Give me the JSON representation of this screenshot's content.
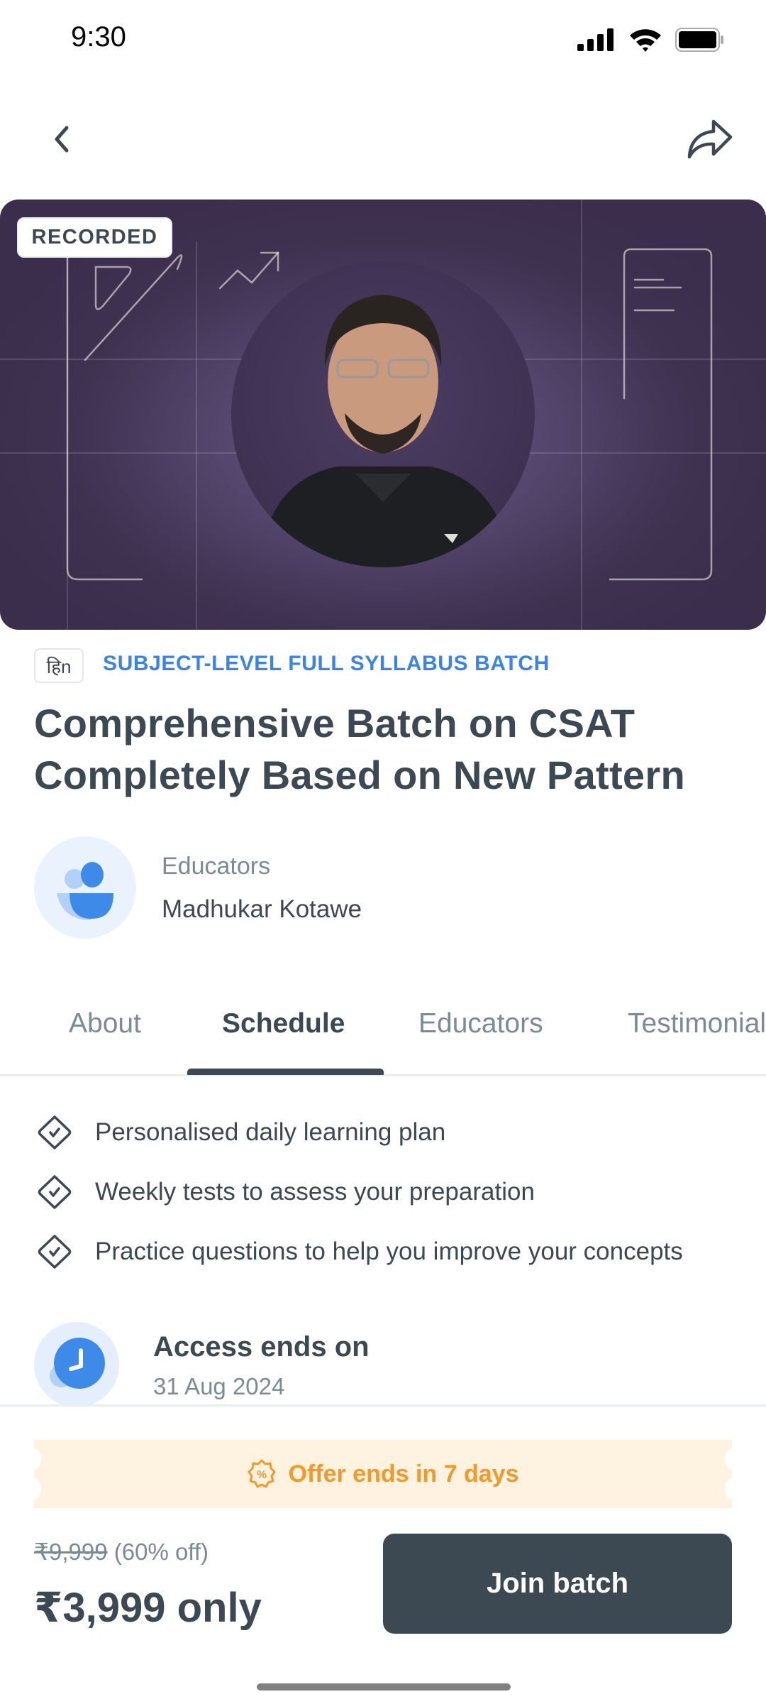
{
  "status_bar": {
    "time": "9:30",
    "icons": [
      "signal-icon",
      "wifi-icon",
      "battery-icon"
    ]
  },
  "nav": {
    "back_icon": "chevron-left-icon",
    "share_icon": "share-icon"
  },
  "banner": {
    "badge": "RECORDED",
    "background_color": "#3f3150"
  },
  "course": {
    "language_chip": "हिn",
    "batch_type": "SUBJECT-LEVEL FULL SYLLABUS BATCH",
    "title_line1": "Comprehensive Batch on CSAT",
    "title_line2": "Completely Based on New Pattern"
  },
  "educators": {
    "label": "Educators",
    "name": "Madhukar Kotawe"
  },
  "tabs": [
    {
      "label": "About",
      "active": false
    },
    {
      "label": "Schedule",
      "active": true
    },
    {
      "label": "Educators",
      "active": false
    },
    {
      "label": "Testimonials",
      "active": false
    }
  ],
  "features": [
    "Personalised daily learning plan",
    "Weekly tests to assess your preparation",
    "Practice questions to help you improve your concepts"
  ],
  "access": {
    "title": "Access ends on",
    "date": "31 Aug 2024"
  },
  "offer": {
    "text": "Offer ends in 7 days",
    "color": "#f4982a"
  },
  "pricing": {
    "original_price": "₹9,999",
    "discount": "(60% off)",
    "final_price": "₹3,999 only"
  },
  "cta": {
    "label": "Join batch"
  },
  "colors": {
    "accent_blue": "#3b83e6",
    "text_dark": "#3c4852",
    "text_muted": "#7a8b94"
  }
}
